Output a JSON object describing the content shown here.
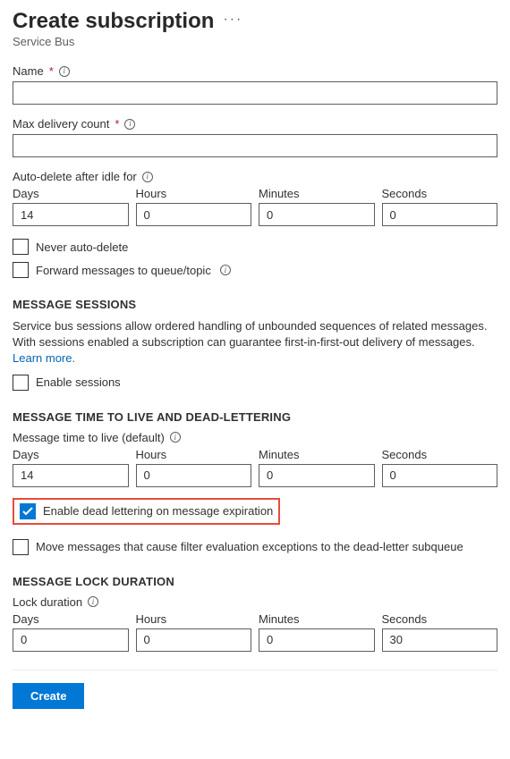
{
  "header": {
    "title": "Create subscription",
    "subtitle": "Service Bus"
  },
  "fields": {
    "name": {
      "label": "Name",
      "value": ""
    },
    "maxDelivery": {
      "label": "Max delivery count",
      "value": ""
    },
    "autoDelete": {
      "label": "Auto-delete after idle for",
      "daysLabel": "Days",
      "hoursLabel": "Hours",
      "minutesLabel": "Minutes",
      "secondsLabel": "Seconds",
      "days": "14",
      "hours": "0",
      "minutes": "0",
      "seconds": "0"
    },
    "neverAutoDelete": {
      "label": "Never auto-delete",
      "checked": false
    },
    "forward": {
      "label": "Forward messages to queue/topic",
      "checked": false
    }
  },
  "sessions": {
    "title": "MESSAGE SESSIONS",
    "desc": "Service bus sessions allow ordered handling of unbounded sequences of related messages. With sessions enabled a subscription can guarantee first-in-first-out delivery of messages.",
    "learnMore": "Learn more.",
    "enable": {
      "label": "Enable sessions",
      "checked": false
    }
  },
  "ttl": {
    "title": "MESSAGE TIME TO LIVE AND DEAD-LETTERING",
    "label": "Message time to live (default)",
    "daysLabel": "Days",
    "hoursLabel": "Hours",
    "minutesLabel": "Minutes",
    "secondsLabel": "Seconds",
    "days": "14",
    "hours": "0",
    "minutes": "0",
    "seconds": "0",
    "deadLetter": {
      "label": "Enable dead lettering on message expiration",
      "checked": true
    },
    "moveExceptions": {
      "label": "Move messages that cause filter evaluation exceptions to the dead-letter subqueue",
      "checked": false
    }
  },
  "lock": {
    "title": "MESSAGE LOCK DURATION",
    "label": "Lock duration",
    "daysLabel": "Days",
    "hoursLabel": "Hours",
    "minutesLabel": "Minutes",
    "secondsLabel": "Seconds",
    "days": "0",
    "hours": "0",
    "minutes": "0",
    "seconds": "30"
  },
  "footer": {
    "create": "Create"
  }
}
